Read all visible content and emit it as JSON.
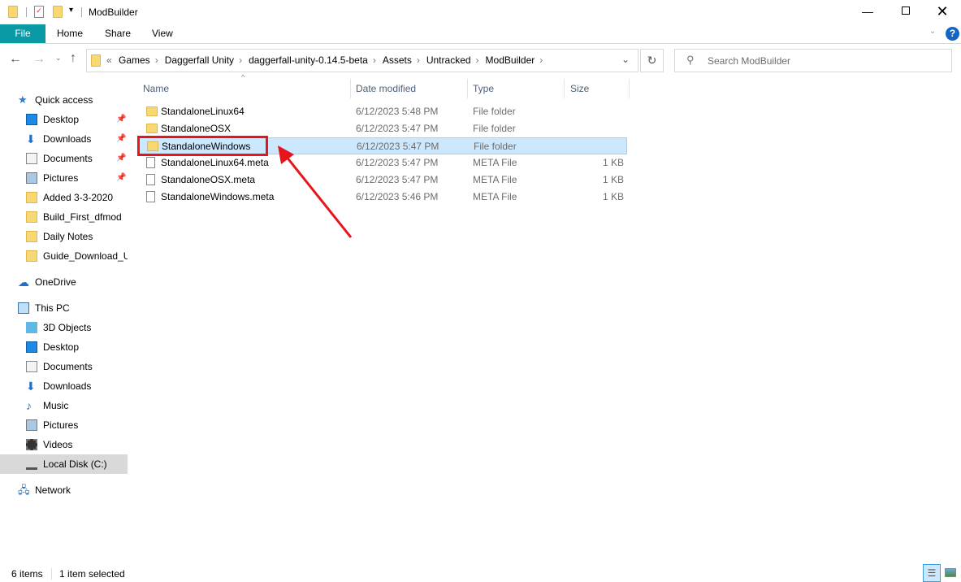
{
  "window": {
    "title": "ModBuilder"
  },
  "ribbon": {
    "tabs": [
      "File",
      "Home",
      "Share",
      "View"
    ]
  },
  "address": {
    "overflow": "«",
    "crumbs": [
      "Games",
      "Daggerfall Unity",
      "daggerfall-unity-0.14.5-beta",
      "Assets",
      "Untracked",
      "ModBuilder"
    ]
  },
  "search": {
    "placeholder": "Search ModBuilder"
  },
  "sidebar": {
    "items": [
      {
        "label": "Quick access",
        "icon": "star-icon",
        "level": 0,
        "pinned": false
      },
      {
        "label": "Desktop",
        "icon": "desktop-icon",
        "level": 1,
        "pinned": true
      },
      {
        "label": "Downloads",
        "icon": "download-icon",
        "level": 1,
        "pinned": true
      },
      {
        "label": "Documents",
        "icon": "documents-icon",
        "level": 1,
        "pinned": true
      },
      {
        "label": "Pictures",
        "icon": "pictures-icon",
        "level": 1,
        "pinned": true
      },
      {
        "label": "Added 3-3-2020",
        "icon": "folder-icon",
        "level": 1,
        "pinned": false
      },
      {
        "label": "Build_First_dfmod",
        "icon": "folder-icon",
        "level": 1,
        "pinned": false
      },
      {
        "label": "Daily Notes",
        "icon": "folder-icon",
        "level": 1,
        "pinned": false
      },
      {
        "label": "Guide_Download_U",
        "icon": "folder-icon",
        "level": 1,
        "pinned": false
      },
      {
        "label": "OneDrive",
        "icon": "cloud-icon",
        "level": 0,
        "gap": true
      },
      {
        "label": "This PC",
        "icon": "computer-icon",
        "level": 0,
        "gap": true
      },
      {
        "label": "3D Objects",
        "icon": "cube-icon",
        "level": 1
      },
      {
        "label": "Desktop",
        "icon": "desktop-icon",
        "level": 1
      },
      {
        "label": "Documents",
        "icon": "documents-icon",
        "level": 1
      },
      {
        "label": "Downloads",
        "icon": "download-icon",
        "level": 1
      },
      {
        "label": "Music",
        "icon": "music-icon",
        "level": 1
      },
      {
        "label": "Pictures",
        "icon": "pictures-icon",
        "level": 1
      },
      {
        "label": "Videos",
        "icon": "videos-icon",
        "level": 1
      },
      {
        "label": "Local Disk (C:)",
        "icon": "drive-icon",
        "level": 1,
        "selected": true
      },
      {
        "label": "Network",
        "icon": "network-icon",
        "level": 0,
        "gap": true
      }
    ]
  },
  "columns": [
    "Name",
    "Date modified",
    "Type",
    "Size"
  ],
  "files": [
    {
      "name": "StandaloneLinux64",
      "date": "6/12/2023 5:48 PM",
      "type": "File folder",
      "size": "",
      "folder": true
    },
    {
      "name": "StandaloneOSX",
      "date": "6/12/2023 5:47 PM",
      "type": "File folder",
      "size": "",
      "folder": true
    },
    {
      "name": "StandaloneWindows",
      "date": "6/12/2023 5:47 PM",
      "type": "File folder",
      "size": "",
      "folder": true,
      "selected": true
    },
    {
      "name": "StandaloneLinux64.meta",
      "date": "6/12/2023 5:47 PM",
      "type": "META File",
      "size": "1 KB"
    },
    {
      "name": "StandaloneOSX.meta",
      "date": "6/12/2023 5:47 PM",
      "type": "META File",
      "size": "1 KB"
    },
    {
      "name": "StandaloneWindows.meta",
      "date": "6/12/2023 5:46 PM",
      "type": "META File",
      "size": "1 KB"
    }
  ],
  "status": {
    "count": "6 items",
    "selection": "1 item selected"
  },
  "colors": {
    "accent": "#0a9aa6",
    "selection": "#cce8ff",
    "annotation": "#e8141b"
  }
}
